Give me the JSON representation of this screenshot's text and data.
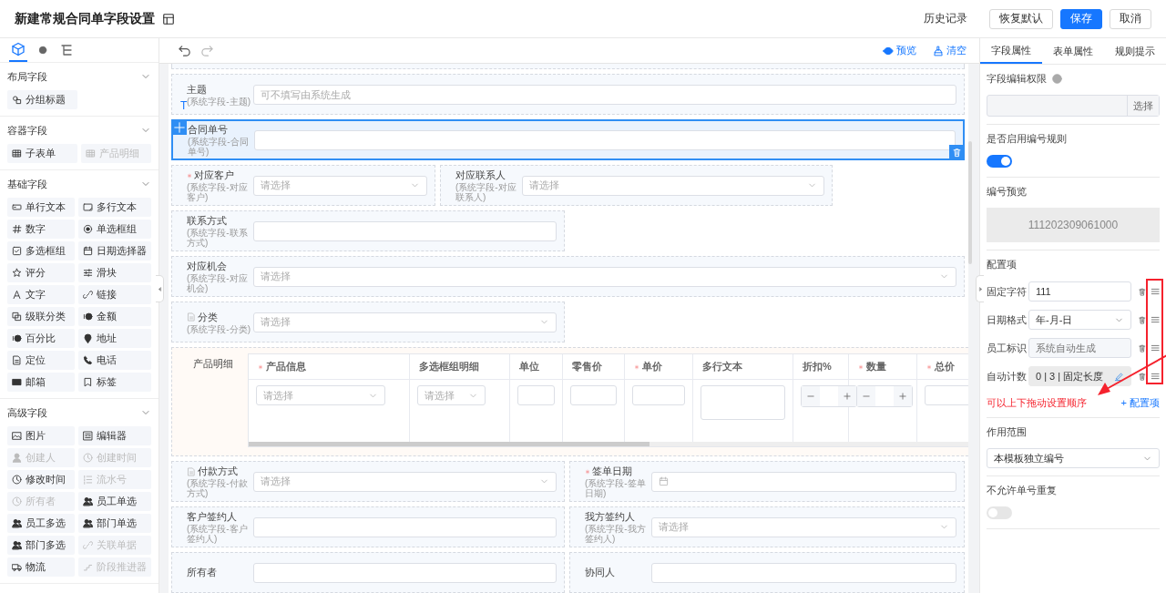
{
  "header": {
    "title": "新建常规合同单字段设置",
    "history_link": "历史记录",
    "buttons": [
      {
        "label": "恢复默认",
        "kind": "default"
      },
      {
        "label": "保存",
        "kind": "primary"
      },
      {
        "label": "取消",
        "kind": "default"
      }
    ]
  },
  "palette": {
    "tabs": [
      {
        "kind": "cube",
        "selected": true
      },
      {
        "kind": "help",
        "selected": false
      },
      {
        "kind": "tree",
        "selected": false
      }
    ],
    "groups": [
      {
        "title": "布局字段",
        "items": [
          {
            "label": "分组标题",
            "kind": "group",
            "disabled": false
          }
        ]
      },
      {
        "title": "容器字段",
        "items": [
          {
            "label": "子表单",
            "kind": "grid",
            "disabled": false
          },
          {
            "label": "产品明细",
            "kind": "grid",
            "disabled": true
          }
        ]
      },
      {
        "title": "基础字段",
        "items": [
          {
            "label": "单行文本",
            "kind": "singleline",
            "disabled": false
          },
          {
            "label": "多行文本",
            "kind": "multiline",
            "disabled": false
          },
          {
            "label": "数字",
            "kind": "number",
            "disabled": false
          },
          {
            "label": "单选框组",
            "kind": "radio",
            "disabled": false
          },
          {
            "label": "多选框组",
            "kind": "checkbox",
            "disabled": false
          },
          {
            "label": "日期选择器",
            "kind": "date",
            "disabled": false
          },
          {
            "label": "评分",
            "kind": "star",
            "disabled": false
          },
          {
            "label": "滑块",
            "kind": "slider",
            "disabled": false
          },
          {
            "label": "文字",
            "kind": "font",
            "disabled": false
          },
          {
            "label": "链接",
            "kind": "link",
            "disabled": false
          },
          {
            "label": "级联分类",
            "kind": "cascade",
            "disabled": false
          },
          {
            "label": "金额",
            "kind": "money",
            "disabled": false
          },
          {
            "label": "百分比",
            "kind": "money",
            "disabled": false
          },
          {
            "label": "地址",
            "kind": "pin",
            "disabled": false
          },
          {
            "label": "定位",
            "kind": "doc",
            "disabled": false
          },
          {
            "label": "电话",
            "kind": "phone",
            "disabled": false
          },
          {
            "label": "邮箱",
            "kind": "mail",
            "disabled": false
          },
          {
            "label": "标签",
            "kind": "tag",
            "disabled": false
          }
        ]
      },
      {
        "title": "高级字段",
        "items": [
          {
            "label": "图片",
            "kind": "image",
            "disabled": false
          },
          {
            "label": "编辑器",
            "kind": "editor",
            "disabled": false
          },
          {
            "label": "创建人",
            "kind": "person",
            "disabled": true
          },
          {
            "label": "创建时间",
            "kind": "clock",
            "disabled": true
          },
          {
            "label": "修改时间",
            "kind": "clock",
            "disabled": false
          },
          {
            "label": "流水号",
            "kind": "serial",
            "disabled": true
          },
          {
            "label": "所有者",
            "kind": "clock",
            "disabled": true
          },
          {
            "label": "员工单选",
            "kind": "people",
            "disabled": false
          },
          {
            "label": "员工多选",
            "kind": "people",
            "disabled": false
          },
          {
            "label": "部门单选",
            "kind": "people",
            "disabled": false
          },
          {
            "label": "部门多选",
            "kind": "people",
            "disabled": false
          },
          {
            "label": "关联单据",
            "kind": "link",
            "disabled": true
          },
          {
            "label": "物流",
            "kind": "truck",
            "disabled": false
          },
          {
            "label": "阶段推进器",
            "kind": "steps",
            "disabled": true
          }
        ]
      }
    ]
  },
  "canvas": {
    "toolbar": {
      "preview": "预览",
      "clear": "清空"
    },
    "rows": [
      [
        {
          "label": "主题",
          "note": "(系统字段-主题)",
          "kind": "input",
          "placeholder": "可不填写由系统生成",
          "badge": "T",
          "required": false,
          "selected": false,
          "locked": false
        }
      ],
      [
        {
          "label": "合同单号",
          "note": "(系统字段-合同单号)",
          "kind": "input",
          "required": false,
          "selected": true,
          "locked": false
        }
      ],
      [
        {
          "label": "对应客户",
          "note": "(系统字段-对应客户)",
          "kind": "select",
          "placeholder": "请选择",
          "required": true,
          "selected": false,
          "locked": false
        },
        {
          "label": "对应联系人",
          "note": "(系统字段-对应联系人)",
          "kind": "select",
          "placeholder": "请选择",
          "required": false,
          "selected": false,
          "locked": false
        }
      ],
      [
        {
          "label": "联系方式",
          "note": "(系统字段-联系方式)",
          "kind": "input",
          "required": false,
          "selected": false,
          "locked": false
        }
      ],
      [
        {
          "label": "对应机会",
          "note": "(系统字段-对应机会)",
          "kind": "select",
          "placeholder": "请选择",
          "required": false,
          "selected": false,
          "locked": false
        }
      ],
      [
        {
          "label": "分类",
          "note": "(系统字段-分类)",
          "kind": "select",
          "placeholder": "请选择",
          "required": false,
          "selected": false,
          "locked": true
        }
      ],
      [
        {
          "label": "产品明细",
          "kind": "table",
          "required": false,
          "selected": false,
          "locked": false,
          "columns": [
            {
              "title": "产品信息",
              "kind": "select",
              "placeholder": "请选择",
              "required": true
            },
            {
              "title": "多选框组明细",
              "kind": "select",
              "placeholder": "请选择",
              "required": false
            },
            {
              "title": "单位",
              "kind": "input",
              "required": false
            },
            {
              "title": "零售价",
              "kind": "input",
              "required": false
            },
            {
              "title": "单价",
              "kind": "input",
              "required": true
            },
            {
              "title": "多行文本",
              "kind": "textarea",
              "required": false
            },
            {
              "title": "折扣%",
              "kind": "stepper",
              "required": false
            },
            {
              "title": "数量",
              "kind": "stepper",
              "required": true
            },
            {
              "title": "总价",
              "kind": "input",
              "required": true
            }
          ]
        }
      ],
      [
        {
          "label": "付款方式",
          "note": "(系统字段-付款方式)",
          "kind": "select",
          "placeholder": "请选择",
          "required": false,
          "selected": false,
          "locked": true
        },
        {
          "label": "签单日期",
          "note": "(系统字段-签单日期)",
          "kind": "date",
          "required": true,
          "selected": false,
          "locked": false
        }
      ],
      [
        {
          "label": "客户签约人",
          "note": "(系统字段-客户签约人)",
          "kind": "input",
          "required": false,
          "selected": false,
          "locked": false
        },
        {
          "label": "我方签约人",
          "note": "(系统字段-我方签约人)",
          "kind": "select",
          "placeholder": "请选择",
          "required": false,
          "selected": false,
          "locked": false
        }
      ],
      [
        {
          "label": "所有者",
          "kind": "input",
          "required": false,
          "selected": false,
          "locked": false
        },
        {
          "label": "协同人",
          "kind": "input",
          "required": false,
          "selected": false,
          "locked": false
        }
      ]
    ]
  },
  "props": {
    "tabs": [
      {
        "label": "字段属性",
        "selected": true
      },
      {
        "label": "表单属性",
        "selected": false
      },
      {
        "label": "规则提示",
        "selected": false
      }
    ],
    "permission": {
      "label": "字段编辑权限",
      "button": "选择"
    },
    "numbering": {
      "label": "是否启用编号规则",
      "on": true
    },
    "preview": {
      "label": "编号预览",
      "value": "111202309061000"
    },
    "config": {
      "label": "配置项",
      "items": [
        {
          "label": "固定字符",
          "kind": "input",
          "value": "111"
        },
        {
          "label": "日期格式",
          "kind": "select",
          "value": "年-月-日"
        },
        {
          "label": "员工标识",
          "kind": "disabled",
          "placeholder": "系统自动生成"
        },
        {
          "label": "自动计数",
          "kind": "readonly",
          "value": "0 | 3 | 固定长度"
        }
      ],
      "add": "+ 配置项"
    },
    "hint": "可以上下拖动设置顺序",
    "scope": {
      "label": "作用范围",
      "value": "本模板独立编号"
    },
    "unique": {
      "label": "不允许单号重复",
      "on": false
    }
  }
}
